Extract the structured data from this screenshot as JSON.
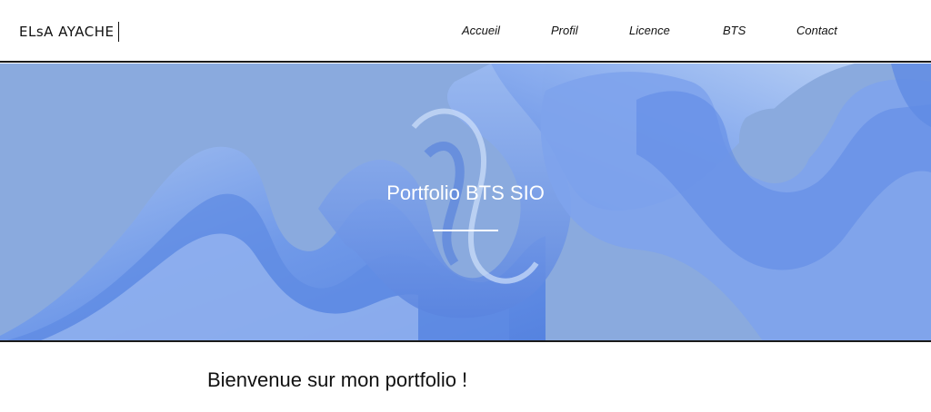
{
  "header": {
    "logo_text": "ELsA AYACHE",
    "nav": [
      {
        "label": "Accueil"
      },
      {
        "label": "Profil"
      },
      {
        "label": "Licence"
      },
      {
        "label": "BTS"
      },
      {
        "label": "Contact"
      }
    ]
  },
  "hero": {
    "title": "Portfolio BTS SIO",
    "background_color": "#8aaade",
    "ribbon_color": "#6f9be8"
  },
  "main": {
    "welcome_text": "Bienvenue sur mon portfolio !"
  }
}
